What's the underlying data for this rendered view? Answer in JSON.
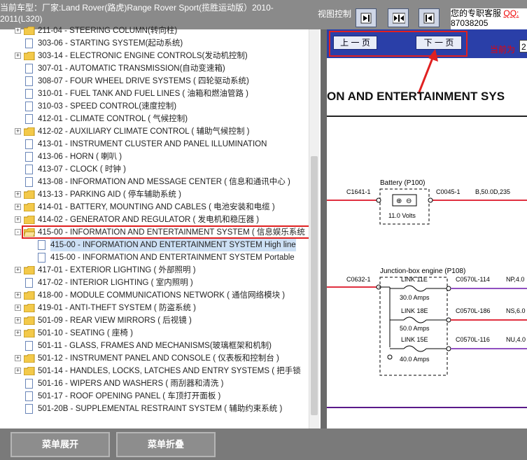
{
  "header": {
    "title": "当前车型：厂家:Land Rover(路虎)Range Rover Sport(揽胜运动版）2010-2011(L320)",
    "view_control_label": "视图控制",
    "support_text": "您的专职客服",
    "support_qq": "QQ:",
    "support_number": "87038205"
  },
  "view_buttons": [
    {
      "icon": "arrow-right-bar-icon"
    },
    {
      "icon": "arrows-inward-icon"
    },
    {
      "icon": "arrow-left-bar-icon"
    }
  ],
  "tree": {
    "items": [
      {
        "expander": "+",
        "icon": "folder",
        "label": "211-04 - STEERING COLUMN(转向柱)"
      },
      {
        "expander": "",
        "icon": "doc",
        "label": "303-06 - STARTING SYSTEM(起动系统)"
      },
      {
        "expander": "+",
        "icon": "folder",
        "label": "303-14 - ELECTRONIC ENGINE CONTROLS(发动机控制)"
      },
      {
        "expander": "",
        "icon": "doc",
        "label": "307-01 - AUTOMATIC TRANSMISSION(自动变速箱)"
      },
      {
        "expander": "",
        "icon": "doc",
        "label": "308-07 - FOUR WHEEL DRIVE SYSTEMS ( 四轮驱动系统)"
      },
      {
        "expander": "",
        "icon": "doc",
        "label": "310-01 - FUEL TANK AND FUEL LINES ( 油箱和燃油管路 )"
      },
      {
        "expander": "",
        "icon": "doc",
        "label": "310-03 - SPEED CONTROL(速度控制)"
      },
      {
        "expander": "",
        "icon": "doc",
        "label": "412-01 - CLIMATE CONTROL ( 气候控制)"
      },
      {
        "expander": "+",
        "icon": "folder",
        "label": "412-02 - AUXILIARY CLIMATE CONTROL ( 辅助气候控制 )"
      },
      {
        "expander": "",
        "icon": "doc",
        "label": "413-01 - INSTRUMENT CLUSTER AND PANEL ILLUMINATION"
      },
      {
        "expander": "",
        "icon": "doc",
        "label": "413-06 - HORN ( 喇叭 )"
      },
      {
        "expander": "",
        "icon": "doc",
        "label": "413-07 - CLOCK ( 时钟 )"
      },
      {
        "expander": "",
        "icon": "doc",
        "label": "413-08 - INFORMATION AND MESSAGE CENTER ( 信息和通讯中心 )"
      },
      {
        "expander": "+",
        "icon": "folder",
        "label": "413-13 - PARKING AID ( 停车辅助系统 )"
      },
      {
        "expander": "+",
        "icon": "folder",
        "label": "414-01 - BATTERY, MOUNTING AND CABLES ( 电池安装和电缆 )"
      },
      {
        "expander": "+",
        "icon": "folder",
        "label": "414-02 - GENERATOR AND REGULATOR ( 发电机和稳压器 )"
      },
      {
        "expander": "-",
        "icon": "folder-open",
        "label": "415-00 - INFORMATION AND ENTERTAINMENT SYSTEM ( 信息娱乐系统"
      },
      {
        "expander": "",
        "icon": "doc",
        "child": true,
        "selected": true,
        "label": "415-00 - INFORMATION AND ENTERTAINMENT SYSTEM High line"
      },
      {
        "expander": "",
        "icon": "doc",
        "child": true,
        "label": "415-00 - INFORMATION AND ENTERTAINMENT SYSTEM Portable"
      },
      {
        "expander": "+",
        "icon": "folder",
        "label": "417-01 - EXTERIOR LIGHTING ( 外部照明 )"
      },
      {
        "expander": "",
        "icon": "doc",
        "label": "417-02 - INTERIOR LIGHTING ( 室内照明 )"
      },
      {
        "expander": "+",
        "icon": "folder",
        "label": "418-00 - MODULE COMMUNICATIONS NETWORK ( 通信网络模块 )"
      },
      {
        "expander": "+",
        "icon": "folder",
        "label": "419-01 - ANTI-THEFT SYSTEM ( 防盗系统 )"
      },
      {
        "expander": "+",
        "icon": "folder",
        "label": "501-09 - REAR VIEW MIRRORS ( 后视镜 )"
      },
      {
        "expander": "+",
        "icon": "folder",
        "label": "501-10 - SEATING ( 座椅 )"
      },
      {
        "expander": "",
        "icon": "doc",
        "label": "501-11 - GLASS, FRAMES AND MECHANISMS(玻璃框架和机制)"
      },
      {
        "expander": "+",
        "icon": "folder",
        "label": "501-12 - INSTRUMENT PANEL AND CONSOLE ( 仪表板和控制台 )"
      },
      {
        "expander": "+",
        "icon": "folder",
        "label": "501-14 - HANDLES, LOCKS, LATCHES AND ENTRY SYSTEMS ( 把手锁"
      },
      {
        "expander": "",
        "icon": "doc",
        "label": "501-16 - WIPERS AND WASHERS ( 雨刮器和清洗 )"
      },
      {
        "expander": "",
        "icon": "doc",
        "label": "501-17 - ROOF OPENING PANEL ( 车顶打开面板 )"
      },
      {
        "expander": "",
        "icon": "doc",
        "label": "501-20B - SUPPLEMENTAL RESTRAINT SYSTEM ( 辅助约束系统 )"
      }
    ]
  },
  "nav": {
    "prev_label": "上 一 页",
    "next_label": "下 一 页",
    "current_label": "当前为",
    "current_value": "2"
  },
  "document": {
    "heading": "ON AND ENTERTAINMENT SYS",
    "battery_title": "Battery (P100)",
    "battery_volts": "11.0 Volts",
    "wire_left_top": "C1641-1",
    "wire_right_top": "C0045-1",
    "wire_spec_top": "B,50.0D,235",
    "jbox_title": "Junction-box engine (P108)",
    "wire_left_mid": "C0632-1",
    "links": [
      {
        "name": "LINK 11E",
        "amps": "30.0 Amps",
        "conn": "C0570L-114",
        "spec": "NP,4.0"
      },
      {
        "name": "LINK 18E",
        "amps": "50.0 Amps",
        "conn": "C0570L-186",
        "spec": "NS,6.0"
      },
      {
        "name": "LINK 15E",
        "amps": "40.0 Amps",
        "conn": "C0570L-116",
        "spec": "NU,4.0"
      }
    ]
  },
  "bottom": {
    "expand_label": "菜单展开",
    "collapse_label": "菜单折叠"
  },
  "colors": {
    "accent_red": "#e02020",
    "nav_blue": "#2a3fa8",
    "wire_red": "#e03040",
    "wire_purple": "#9050c0",
    "wire_dark_purple": "#5a1a8a"
  }
}
